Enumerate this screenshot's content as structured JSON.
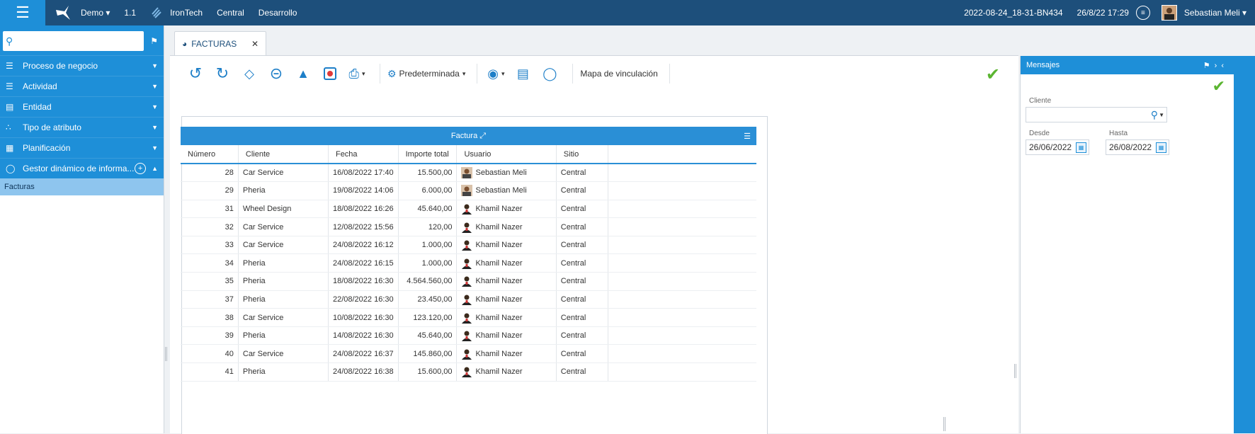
{
  "topbar": {
    "env": "Demo",
    "version": "1.1",
    "company": "IronTech",
    "site": "Central",
    "mode": "Desarrollo",
    "build": "2022-08-24_18-31-BN434",
    "datetime": "26/8/22 17:29",
    "user": "Sebastian Meli"
  },
  "sidebar": {
    "search_placeholder": "",
    "items": [
      {
        "label": "Proceso de negocio"
      },
      {
        "label": "Actividad"
      },
      {
        "label": "Entidad"
      },
      {
        "label": "Tipo de atributo"
      },
      {
        "label": "Planificación"
      },
      {
        "label": "Gestor dinámico de informa..."
      }
    ],
    "sub_item": "Facturas"
  },
  "tab": {
    "label": "FACTURAS"
  },
  "toolbar": {
    "view_label": "Predeterminada",
    "map_label": "Mapa de vinculación"
  },
  "grid": {
    "title": "Factura",
    "columns": [
      "Número",
      "Cliente",
      "Fecha",
      "Importe total",
      "Usuario",
      "Sitio"
    ],
    "rows": [
      {
        "numero": "28",
        "cliente": "Car Service",
        "fecha": "16/08/2022 17:40",
        "importe": "15.500,00",
        "usuario": "Sebastian Meli",
        "sitio": "Central"
      },
      {
        "numero": "29",
        "cliente": "Pheria",
        "fecha": "19/08/2022 14:06",
        "importe": "6.000,00",
        "usuario": "Sebastian Meli",
        "sitio": "Central"
      },
      {
        "numero": "31",
        "cliente": "Wheel Design",
        "fecha": "18/08/2022 16:26",
        "importe": "45.640,00",
        "usuario": "Khamil Nazer",
        "sitio": "Central"
      },
      {
        "numero": "32",
        "cliente": "Car Service",
        "fecha": "12/08/2022 15:56",
        "importe": "120,00",
        "usuario": "Khamil Nazer",
        "sitio": "Central"
      },
      {
        "numero": "33",
        "cliente": "Car Service",
        "fecha": "24/08/2022 16:12",
        "importe": "1.000,00",
        "usuario": "Khamil Nazer",
        "sitio": "Central"
      },
      {
        "numero": "34",
        "cliente": "Pheria",
        "fecha": "24/08/2022 16:15",
        "importe": "1.000,00",
        "usuario": "Khamil Nazer",
        "sitio": "Central"
      },
      {
        "numero": "35",
        "cliente": "Pheria",
        "fecha": "18/08/2022 16:30",
        "importe": "4.564.560,00",
        "usuario": "Khamil Nazer",
        "sitio": "Central"
      },
      {
        "numero": "37",
        "cliente": "Pheria",
        "fecha": "22/08/2022 16:30",
        "importe": "23.450,00",
        "usuario": "Khamil Nazer",
        "sitio": "Central"
      },
      {
        "numero": "38",
        "cliente": "Car Service",
        "fecha": "10/08/2022 16:30",
        "importe": "123.120,00",
        "usuario": "Khamil Nazer",
        "sitio": "Central"
      },
      {
        "numero": "39",
        "cliente": "Pheria",
        "fecha": "14/08/2022 16:30",
        "importe": "45.640,00",
        "usuario": "Khamil Nazer",
        "sitio": "Central"
      },
      {
        "numero": "40",
        "cliente": "Car Service",
        "fecha": "24/08/2022 16:37",
        "importe": "145.860,00",
        "usuario": "Khamil Nazer",
        "sitio": "Central"
      },
      {
        "numero": "41",
        "cliente": "Pheria",
        "fecha": "24/08/2022 16:38",
        "importe": "15.600,00",
        "usuario": "Khamil Nazer",
        "sitio": "Central"
      }
    ]
  },
  "messages": {
    "title": "Mensajes",
    "cliente_label": "Cliente",
    "cliente_value": "",
    "desde_label": "Desde",
    "desde_value": "26/06/2022",
    "hasta_label": "Hasta",
    "hasta_value": "26/08/2022"
  },
  "colors": {
    "accent": "#1e8fd8",
    "topbar": "#1d4f7b",
    "ok": "#5bb531"
  }
}
